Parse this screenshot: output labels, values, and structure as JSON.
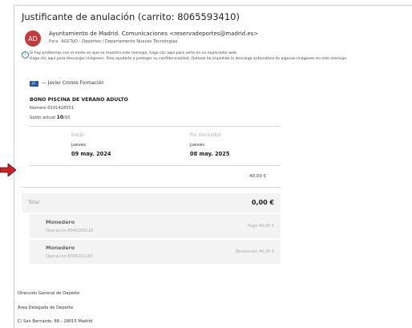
{
  "subject": "Justificante de anulación (carrito: 8065593410)",
  "sender": {
    "initials": "AD",
    "from": "Ayuntamiento de Madrid. Comunicaciones <reservadeportes@madrid.es>",
    "to_label": "Para",
    "to": "AGCTyD - Deportes / Departamento Nuevas Tecnologías",
    "avatar_color": "#c43a3a"
  },
  "info": {
    "line1": "Si hay problemas con el modo en que se muestra este mensaje, haga clic aquí para verlo en un explorador web.",
    "line2": "Haga clic aquí para descargar imágenes. Para ayudarle a proteger su confidencialidad, Outlook ha impedido la descarga automática de algunas imágenes en este mensaje."
  },
  "ticket": {
    "badge": "JC",
    "issuer": "— Javier Cronos Formación",
    "product": "BONO PISCINA DE VERANO ADULTO",
    "number": "Número 0101418551",
    "balance_label": "Saldo actual ",
    "balance_value": "10",
    "balance_total": "/10",
    "start": {
      "label": "Inicio",
      "day": "jueves",
      "date": "09 may. 2024"
    },
    "end": {
      "label": "Fin (incluido)",
      "day": "jueves",
      "date": "08 may. 2025"
    },
    "amount": "40,00 €"
  },
  "total": {
    "label": "Total",
    "value": "0,00 €"
  },
  "operations": [
    {
      "name": "Monedero",
      "number": "Operación 8046269219",
      "amount": "Pago 40,00 €"
    },
    {
      "name": "Monedero",
      "number": "Operación 8046291187",
      "amount": "Devolución 40,00 €"
    }
  ],
  "footer": {
    "line1": "Dirección General de Deporte",
    "line2": "Área Delegada de Deporte",
    "line3": "C/ San Bernardo, 68 - 28015 Madrid"
  },
  "colors": {
    "badge": "#2457a8",
    "info": "#2b6cc4",
    "arrow": "#d62020"
  }
}
